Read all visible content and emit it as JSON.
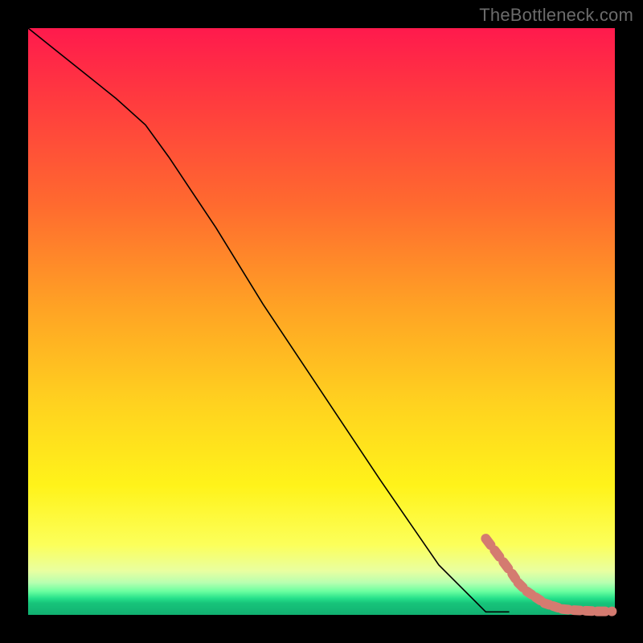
{
  "watermark": "TheBottleneck.com",
  "chart_data": {
    "type": "line",
    "title": "",
    "xlabel": "",
    "ylabel": "",
    "xlim": [
      0,
      100
    ],
    "ylim": [
      0,
      100
    ],
    "grid": false,
    "legend": false,
    "series": [
      {
        "name": "curve",
        "style": "solid-black",
        "x": [
          0,
          5,
          10,
          15,
          20,
          24,
          28,
          32,
          40,
          50,
          60,
          70,
          78,
          82
        ],
        "y": [
          100,
          96,
          92,
          88,
          83.5,
          78,
          72,
          66,
          53,
          38,
          23,
          8.5,
          0.5,
          0.5
        ]
      },
      {
        "name": "highlight-points",
        "style": "salmon-dashed",
        "x": [
          78,
          79.5,
          81,
          82.5,
          83.5,
          85,
          86.5,
          88,
          89.5,
          91,
          93,
          95,
          97,
          99.5
        ],
        "y": [
          13,
          11,
          9,
          7,
          5.5,
          4,
          3,
          2,
          1.5,
          1,
          0.8,
          0.7,
          0.6,
          0.6
        ]
      }
    ],
    "annotations": []
  },
  "colors": {
    "highlight": "#d47b70",
    "curve": "#000000"
  }
}
